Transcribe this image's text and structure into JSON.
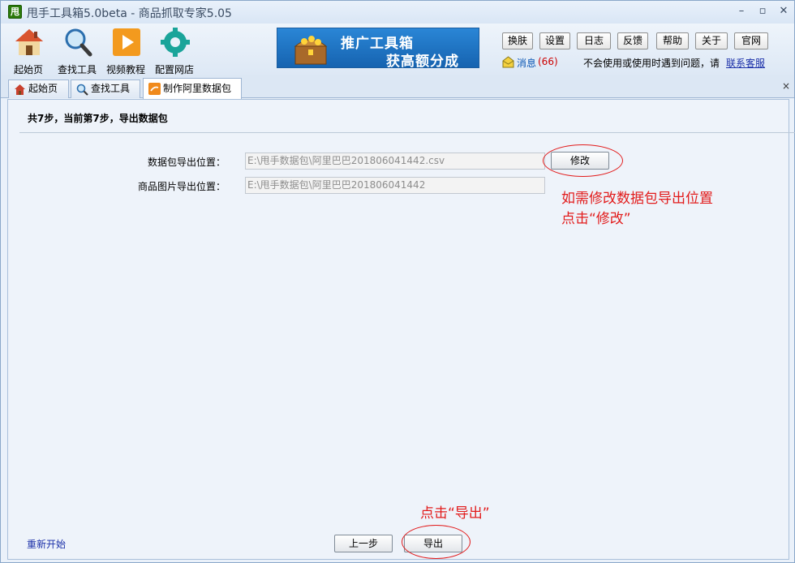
{
  "window": {
    "title": "甩手工具箱5.0beta - 商品抓取专家5.05",
    "app_icon_text": "甩",
    "minimize": "–",
    "maximize": "▫",
    "close": "✕"
  },
  "toolbar": {
    "tools": [
      {
        "label": "起始页",
        "icon": "home-icon"
      },
      {
        "label": "查找工具",
        "icon": "magnifier-icon"
      },
      {
        "label": "视频教程",
        "icon": "play-icon"
      },
      {
        "label": "配置网店",
        "icon": "gear-icon"
      }
    ],
    "banner": {
      "line1": "推广工具箱",
      "line2": "获高额分成"
    },
    "buttons": [
      "换肤",
      "设置",
      "日志",
      "反馈",
      "帮助",
      "关于",
      "官网"
    ],
    "message_label": "消息",
    "message_count": "(66)",
    "help_text": "不会使用或使用时遇到问题，请",
    "service_link": "联系客服"
  },
  "tabs": [
    {
      "label": "起始页",
      "icon": "home-icon"
    },
    {
      "label": "查找工具",
      "icon": "magnifier-icon"
    },
    {
      "label": "制作阿里数据包",
      "icon": "ali-icon"
    }
  ],
  "tab_close": "×",
  "main": {
    "step_title": "共7步，当前第7步，导出数据包",
    "fields": [
      {
        "label": "数据包导出位置：",
        "value": "E:\\甩手数据包\\阿里巴巴201806041442.csv"
      },
      {
        "label": "商品图片导出位置：",
        "value": "E:\\甩手数据包\\阿里巴巴201806041442"
      }
    ],
    "modify_button": "修改",
    "annotation_modify_line1": "如需修改数据包导出位置",
    "annotation_modify_line2": "点击“修改”",
    "annotation_export": "点击“导出”",
    "restart_link": "重新开始",
    "prev_button": "上一步",
    "export_button": "导出"
  },
  "colors": {
    "annotation_red": "#e21b1b",
    "link_blue": "#1a2fa8",
    "banner_blue": "#1663b0"
  }
}
